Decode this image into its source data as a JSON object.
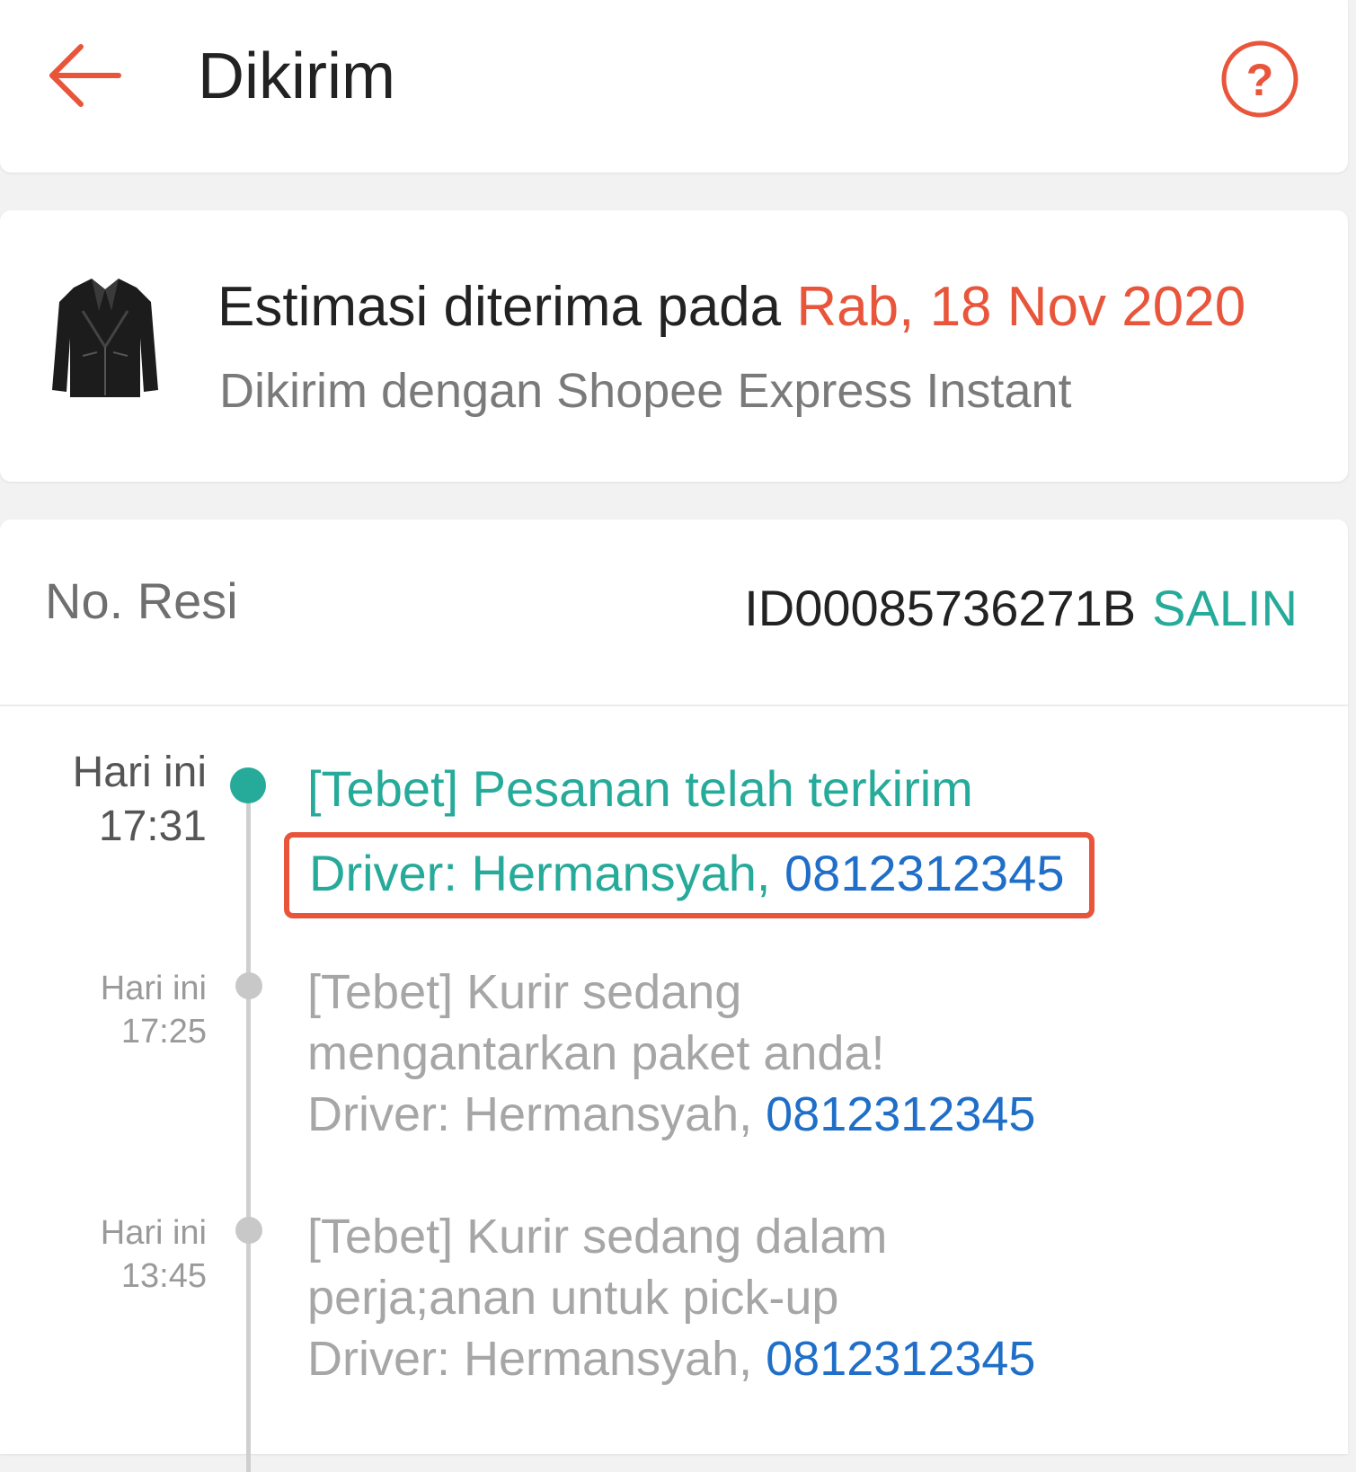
{
  "header": {
    "title": "Dikirim",
    "back_icon": "arrow-left-icon",
    "help_icon": "question-circle-icon"
  },
  "estimate": {
    "prefix": "Estimasi diterima pada",
    "date": "Rab, 18 Nov 2020",
    "shipping": "Dikirim dengan Shopee Express Instant",
    "product_icon": "leather-jacket-image"
  },
  "tracking": {
    "resi_label": "No. Resi",
    "resi_number": "ID00085736271B",
    "copy_label": "SALIN",
    "events": [
      {
        "day": "Hari ini",
        "time": "17:31",
        "title": "[Tebet] Pesanan telah terkirim",
        "driver": "Driver: Hermansyah,",
        "phone": "0812312345"
      },
      {
        "day": "Hari ini",
        "time": "17:25",
        "title_line1": "[Tebet] Kurir sedang",
        "title_line2": "mengantarkan paket anda!",
        "driver": "Driver: Hermansyah,",
        "phone": "0812312345"
      },
      {
        "day": "Hari ini",
        "time": "13:45",
        "title_line1": "[Tebet] Kurir sedang dalam",
        "title_line2": "perja;anan untuk pick-up",
        "driver": "Driver: Hermansyah,",
        "phone": "0812312345"
      }
    ]
  },
  "colors": {
    "accent": "#e8553a",
    "teal": "#26aa99",
    "link": "#1f6ec8"
  }
}
